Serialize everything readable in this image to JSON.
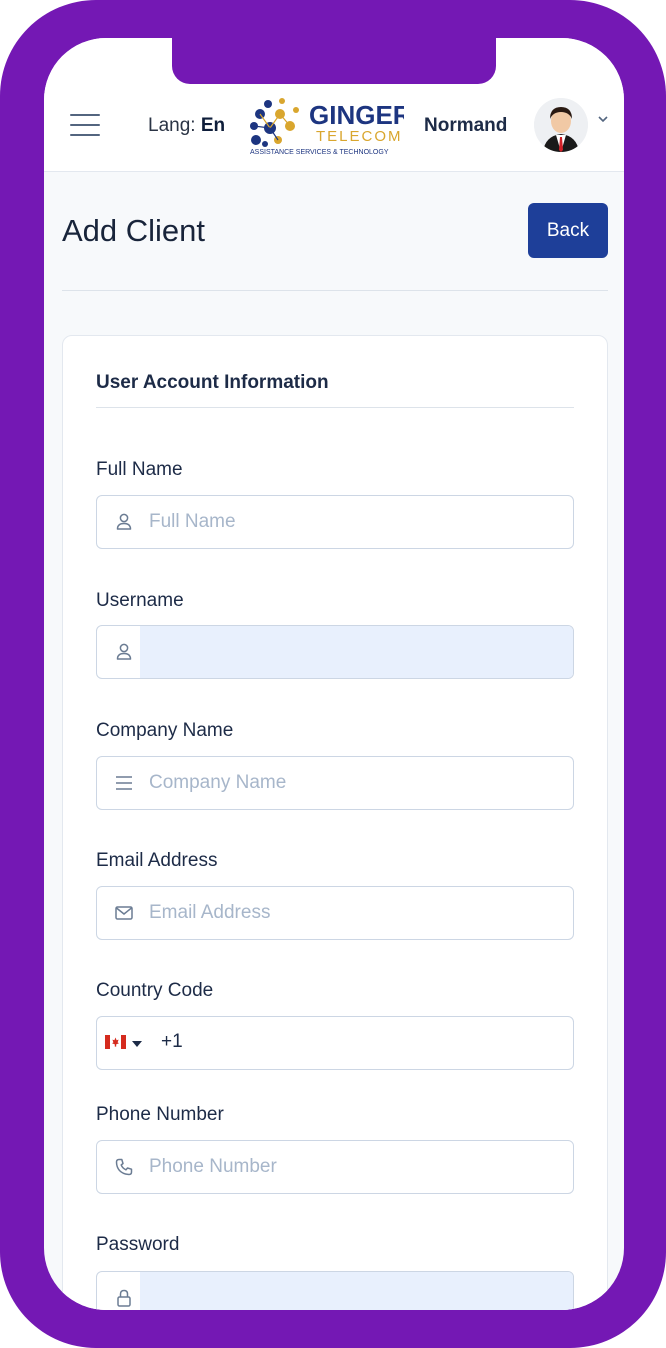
{
  "header": {
    "lang_label": "Lang:",
    "lang_value": "En",
    "logo": {
      "line1": "GINGER",
      "line2": "TELECOM",
      "tagline": "ASSISTANCE SERVICES & TECHNOLOGY"
    },
    "user_name": "Normand"
  },
  "page": {
    "title": "Add Client",
    "back_label": "Back"
  },
  "form": {
    "section_title": "User Account Information",
    "full_name": {
      "label": "Full Name",
      "placeholder": "Full Name",
      "icon": "user-icon"
    },
    "username": {
      "label": "Username",
      "value": "",
      "icon": "user-icon"
    },
    "company": {
      "label": "Company Name",
      "placeholder": "Company Name",
      "icon": "list-icon"
    },
    "email": {
      "label": "Email Address",
      "placeholder": "Email Address",
      "icon": "envelope-icon"
    },
    "country": {
      "label": "Country Code",
      "dial_code": "+1",
      "flag": "canada-flag-icon"
    },
    "phone": {
      "label": "Phone Number",
      "placeholder": "Phone Number",
      "icon": "phone-icon"
    },
    "password": {
      "label": "Password",
      "value": "",
      "icon": "lock-icon"
    }
  },
  "colors": {
    "frame": "#7418b4",
    "primary_button": "#1e3f99",
    "autofill": "#e8f0fd",
    "logo_blue": "#1d3580",
    "logo_gold": "#d9a62e"
  }
}
